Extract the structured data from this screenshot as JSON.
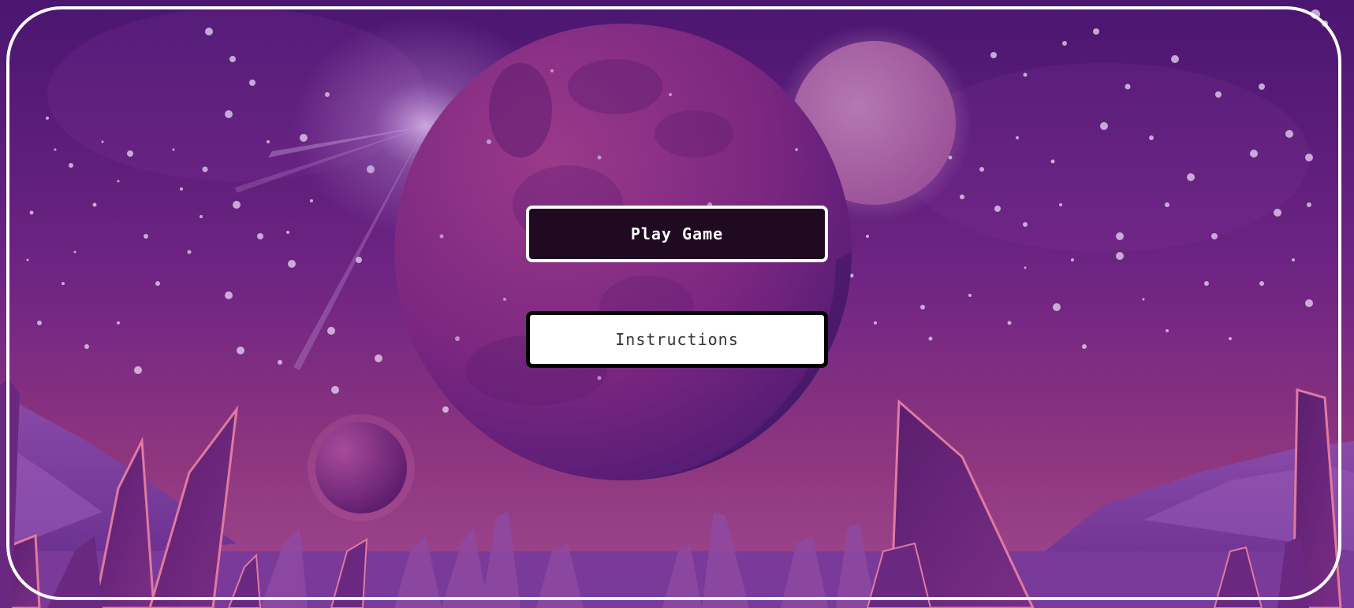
{
  "menu": {
    "play_label": "Play Game",
    "instructions_label": "Instructions"
  },
  "colors": {
    "sky_top": "#4a1670",
    "sky_mid": "#7a2a8a",
    "sky_bottom": "#a04a8e",
    "frame": "#ffffff",
    "play_button_bg": "#1f0a22",
    "instructions_button_bg": "#ffffff"
  }
}
